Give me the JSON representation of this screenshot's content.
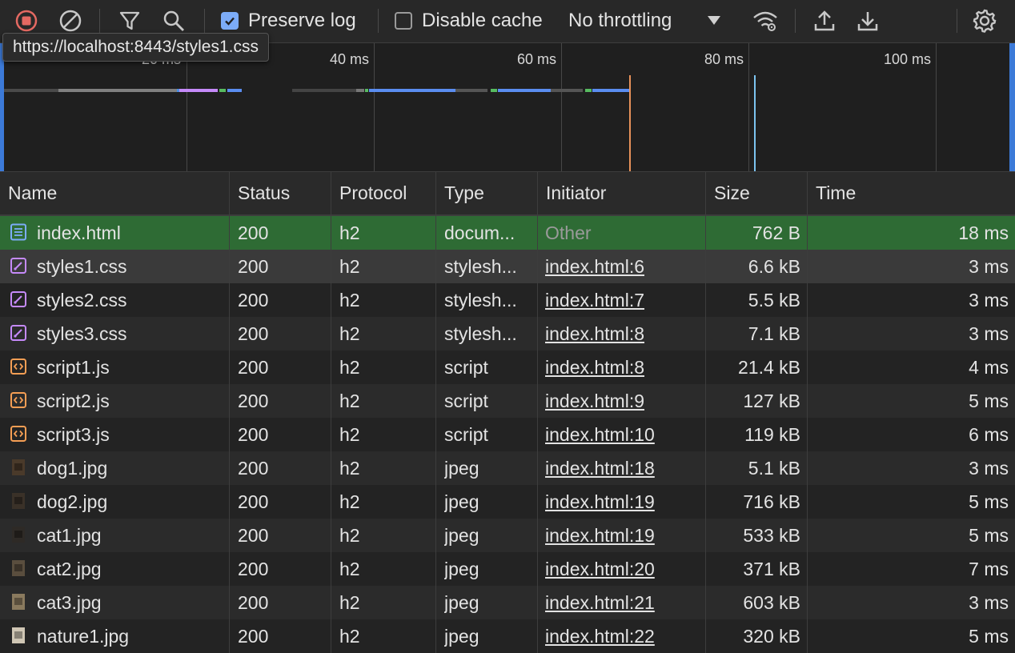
{
  "toolbar": {
    "preserve_log_label": "Preserve log",
    "preserve_log_checked": true,
    "disable_cache_label": "Disable cache",
    "disable_cache_checked": false,
    "throttling_value": "No throttling"
  },
  "tooltip": {
    "text": "https://localhost:8443/styles1.css"
  },
  "overview": {
    "ticks": [
      "20 ms",
      "40 ms",
      "60 ms",
      "80 ms",
      "100 ms"
    ]
  },
  "table": {
    "columns": [
      "Name",
      "Status",
      "Protocol",
      "Type",
      "Initiator",
      "Size",
      "Time"
    ],
    "rows": [
      {
        "icon": "document-icon",
        "name": "index.html",
        "status": "200",
        "protocol": "h2",
        "type": "docum...",
        "initiator": "Other",
        "size": "762 B",
        "time": "18 ms"
      },
      {
        "icon": "stylesheet-icon",
        "name": "styles1.css",
        "status": "200",
        "protocol": "h2",
        "type": "stylesh...",
        "initiator": "index.html:6",
        "size": "6.6 kB",
        "time": "3 ms"
      },
      {
        "icon": "stylesheet-icon",
        "name": "styles2.css",
        "status": "200",
        "protocol": "h2",
        "type": "stylesh...",
        "initiator": "index.html:7",
        "size": "5.5 kB",
        "time": "3 ms"
      },
      {
        "icon": "stylesheet-icon",
        "name": "styles3.css",
        "status": "200",
        "protocol": "h2",
        "type": "stylesh...",
        "initiator": "index.html:8",
        "size": "7.1 kB",
        "time": "3 ms"
      },
      {
        "icon": "script-icon",
        "name": "script1.js",
        "status": "200",
        "protocol": "h2",
        "type": "script",
        "initiator": "index.html:8",
        "size": "21.4 kB",
        "time": "4 ms"
      },
      {
        "icon": "script-icon",
        "name": "script2.js",
        "status": "200",
        "protocol": "h2",
        "type": "script",
        "initiator": "index.html:9",
        "size": "127 kB",
        "time": "5 ms"
      },
      {
        "icon": "script-icon",
        "name": "script3.js",
        "status": "200",
        "protocol": "h2",
        "type": "script",
        "initiator": "index.html:10",
        "size": "119 kB",
        "time": "6 ms"
      },
      {
        "icon": "image-thumbnail-icon",
        "name": "dog1.jpg",
        "status": "200",
        "protocol": "h2",
        "type": "jpeg",
        "initiator": "index.html:18",
        "size": "5.1 kB",
        "time": "3 ms"
      },
      {
        "icon": "image-thumbnail-icon",
        "name": "dog2.jpg",
        "status": "200",
        "protocol": "h2",
        "type": "jpeg",
        "initiator": "index.html:19",
        "size": "716 kB",
        "time": "5 ms"
      },
      {
        "icon": "image-thumbnail-icon",
        "name": "cat1.jpg",
        "status": "200",
        "protocol": "h2",
        "type": "jpeg",
        "initiator": "index.html:19",
        "size": "533 kB",
        "time": "5 ms"
      },
      {
        "icon": "image-thumbnail-icon",
        "name": "cat2.jpg",
        "status": "200",
        "protocol": "h2",
        "type": "jpeg",
        "initiator": "index.html:20",
        "size": "371 kB",
        "time": "7 ms"
      },
      {
        "icon": "image-thumbnail-icon",
        "name": "cat3.jpg",
        "status": "200",
        "protocol": "h2",
        "type": "jpeg",
        "initiator": "index.html:21",
        "size": "603 kB",
        "time": "3 ms"
      },
      {
        "icon": "image-thumbnail-icon",
        "name": "nature1.jpg",
        "status": "200",
        "protocol": "h2",
        "type": "jpeg",
        "initiator": "index.html:22",
        "size": "320 kB",
        "time": "5 ms"
      }
    ]
  },
  "colors": {
    "selected_row": "#2e6b34",
    "hover_row": "#3a3a3a",
    "even_row": "#2b2b2b",
    "odd_row": "#232323",
    "stylesheet_icon": "#c58af9",
    "script_icon": "#f59e54",
    "document_icon": "#7cacf8",
    "record_stop": "#e46962"
  }
}
